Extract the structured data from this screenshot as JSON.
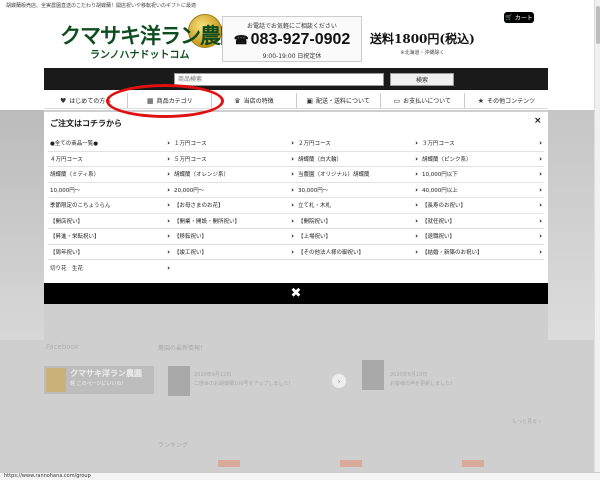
{
  "header": {
    "tagline": "胡蝶蘭販売店。全実農園直送のこだわり胡蝶蘭！開店祝いや移転祝いのギフトに最適",
    "logo_main": "クマサキ洋ラン農園",
    "logo_sub": "ランノハナドットコム",
    "contact_label": "お電話でお気軽にご相談ください",
    "phone": "083-927-0902",
    "hours": "9:00-19:00 日祝定休",
    "shipping": "送料1800円(税込)",
    "shipping_note": "※北海道・沖縄除く",
    "cart_label": "カート"
  },
  "search": {
    "placeholder": "商品検索",
    "button_label": "検索"
  },
  "nav": [
    {
      "icon": "heart-icon",
      "glyph": "♥",
      "label": "はじめての方へ"
    },
    {
      "icon": "grid-icon",
      "glyph": "▦",
      "label": "商品カテゴリ"
    },
    {
      "icon": "trophy-icon",
      "glyph": "♛",
      "label": "当店の特徴"
    },
    {
      "icon": "truck-icon",
      "glyph": "▣",
      "label": "配送・送料について"
    },
    {
      "icon": "payment-card-icon",
      "glyph": "▭",
      "label": "お支払いについて"
    },
    {
      "icon": "star-icon",
      "glyph": "★",
      "label": "その他コンテンツ"
    }
  ],
  "modal": {
    "title": "ご注文はコチラから",
    "close_top": "×",
    "close_bottom": "✖",
    "rows": [
      [
        "●全ての商品一覧●",
        "１万円コース",
        "２万円コース",
        "３万円コース"
      ],
      [
        "４万円コース",
        "５万円コース",
        "胡蝶蘭（白大輪）",
        "胡蝶蘭（ピンク系）"
      ],
      [
        "胡蝶蘭（ミディ系）",
        "胡蝶蘭（オレンジ系）",
        "当農園（オリジナル）胡蝶蘭",
        "10,000円以下"
      ],
      [
        "10,000円〜",
        "20,000円〜",
        "30,000円〜",
        "40,000円以上"
      ],
      [
        "季節限定のこちょうらん",
        "【お母さまのお花】",
        "立て札・木札",
        "【長寿のお祝い】"
      ],
      [
        "【開店祝い】",
        "【開業・開設・開所祝い】",
        "【開院祝い】",
        "【就任祝い】"
      ],
      [
        "【昇進・栄転祝い】",
        "【移転祝い】",
        "【上場祝い】",
        "【退職祝い】"
      ],
      [
        "【周年祝い】",
        "【竣工祝い】",
        "【その他法人様の御祝い】",
        "【結婚・新築のお祝い】"
      ],
      [
        "切り花　生花",
        "",
        "",
        ""
      ]
    ]
  },
  "background": {
    "facebook_label": "Facebook",
    "fb_page_name": "クマサキ洋ラン農園",
    "fb_sub": "軽 このページにいいね！",
    "news_label": "農園の最新情報！",
    "news_1_date": "2020年9月12日",
    "news_1_text": "二度目のお胡蝶蘭100号をアップしました！",
    "news_2_date": "2020年8月18日",
    "news_2_text": "お客様の声を更新しました！",
    "more_label": "もっと見る ›",
    "ranking_label": "ランキング"
  },
  "status_bar": {
    "url": "https://www.rannohana.com/group"
  }
}
